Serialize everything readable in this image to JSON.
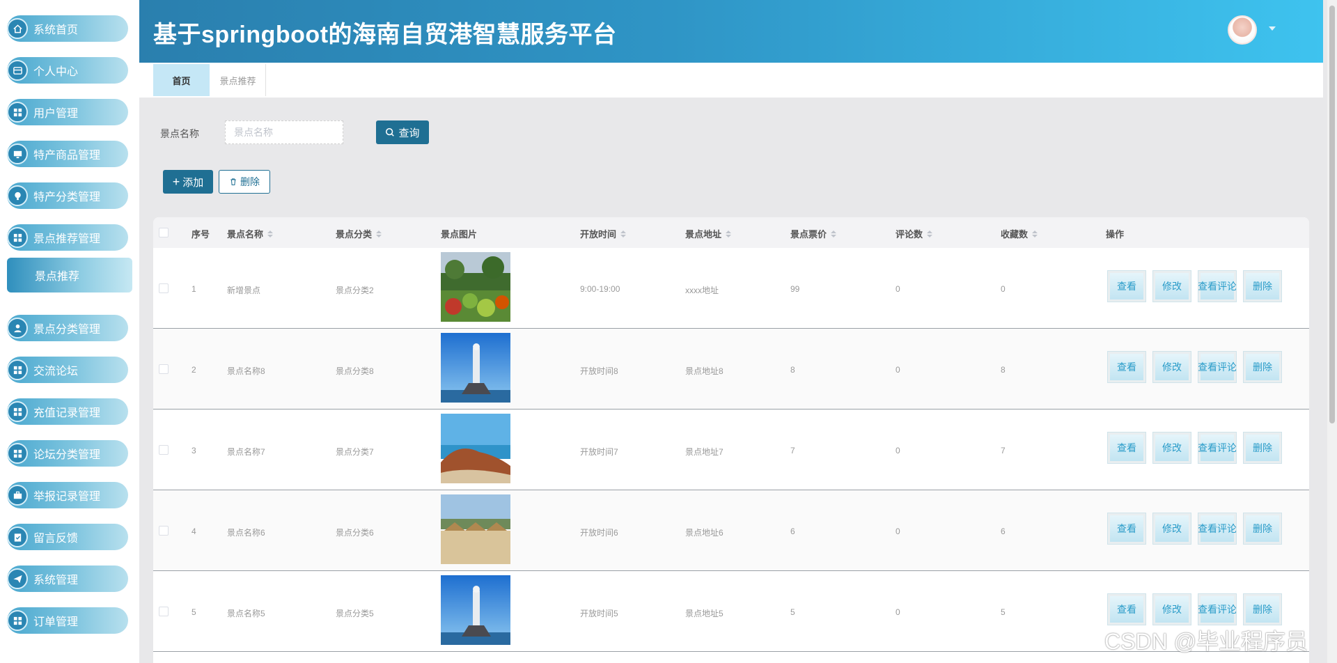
{
  "header": {
    "title": "基于springboot的海南自贸港智慧服务平台"
  },
  "sidebar": {
    "items": [
      {
        "label": "系统首页",
        "icon": "home-icon"
      },
      {
        "label": "个人中心",
        "icon": "card-icon"
      },
      {
        "label": "用户管理",
        "icon": "grid-icon"
      },
      {
        "label": "特产商品管理",
        "icon": "monitor-icon"
      },
      {
        "label": "特产分类管理",
        "icon": "bulb-icon"
      },
      {
        "label": "景点推荐管理",
        "icon": "grid-icon"
      },
      {
        "label": "景点分类管理",
        "icon": "user-icon"
      },
      {
        "label": "交流论坛",
        "icon": "grid-icon"
      },
      {
        "label": "充值记录管理",
        "icon": "grid-icon"
      },
      {
        "label": "论坛分类管理",
        "icon": "grid-icon"
      },
      {
        "label": "举报记录管理",
        "icon": "briefcase-icon"
      },
      {
        "label": "留言反馈",
        "icon": "clipboard-icon"
      },
      {
        "label": "系统管理",
        "icon": "send-icon"
      },
      {
        "label": "订单管理",
        "icon": "grid-icon"
      }
    ],
    "submenu": {
      "label": "景点推荐"
    }
  },
  "tabs": [
    {
      "label": "首页",
      "active": true
    },
    {
      "label": "景点推荐",
      "active": false
    }
  ],
  "search": {
    "label": "景点名称",
    "placeholder": "景点名称",
    "button": "查询"
  },
  "actions": {
    "add": "添加",
    "delete": "删除"
  },
  "table": {
    "columns": [
      "序号",
      "景点名称",
      "景点分类",
      "景点图片",
      "开放时间",
      "景点地址",
      "景点票价",
      "评论数",
      "收藏数",
      "操作"
    ],
    "row_actions": [
      "查看",
      "修改",
      "查看评论",
      "删除"
    ],
    "rows": [
      {
        "index": "1",
        "name": "新增景点",
        "category": "景点分类2",
        "image": "garden-photo",
        "open_time": "9:00-19:00",
        "address": "xxxx地址",
        "price": "99",
        "comments": "0",
        "favorites": "0"
      },
      {
        "index": "2",
        "name": "景点名称8",
        "category": "景点分类8",
        "image": "statue-photo",
        "open_time": "开放时间8",
        "address": "景点地址8",
        "price": "8",
        "comments": "0",
        "favorites": "8"
      },
      {
        "index": "3",
        "name": "景点名称7",
        "category": "景点分类7",
        "image": "rock-coast-photo",
        "open_time": "开放时间7",
        "address": "景点地址7",
        "price": "7",
        "comments": "0",
        "favorites": "7"
      },
      {
        "index": "4",
        "name": "景点名称6",
        "category": "景点分类6",
        "image": "beach-hut-photo",
        "open_time": "开放时间6",
        "address": "景点地址6",
        "price": "6",
        "comments": "0",
        "favorites": "6"
      },
      {
        "index": "5",
        "name": "景点名称5",
        "category": "景点分类5",
        "image": "statue-photo",
        "open_time": "开放时间5",
        "address": "景点地址5",
        "price": "5",
        "comments": "0",
        "favorites": "5"
      }
    ]
  },
  "watermark": "CSDN @毕业程序员",
  "colors": {
    "primary": "#1f6f93",
    "header_start": "#2a7fae",
    "header_end": "#3ec3ef",
    "menu": "#4aa8cf"
  }
}
